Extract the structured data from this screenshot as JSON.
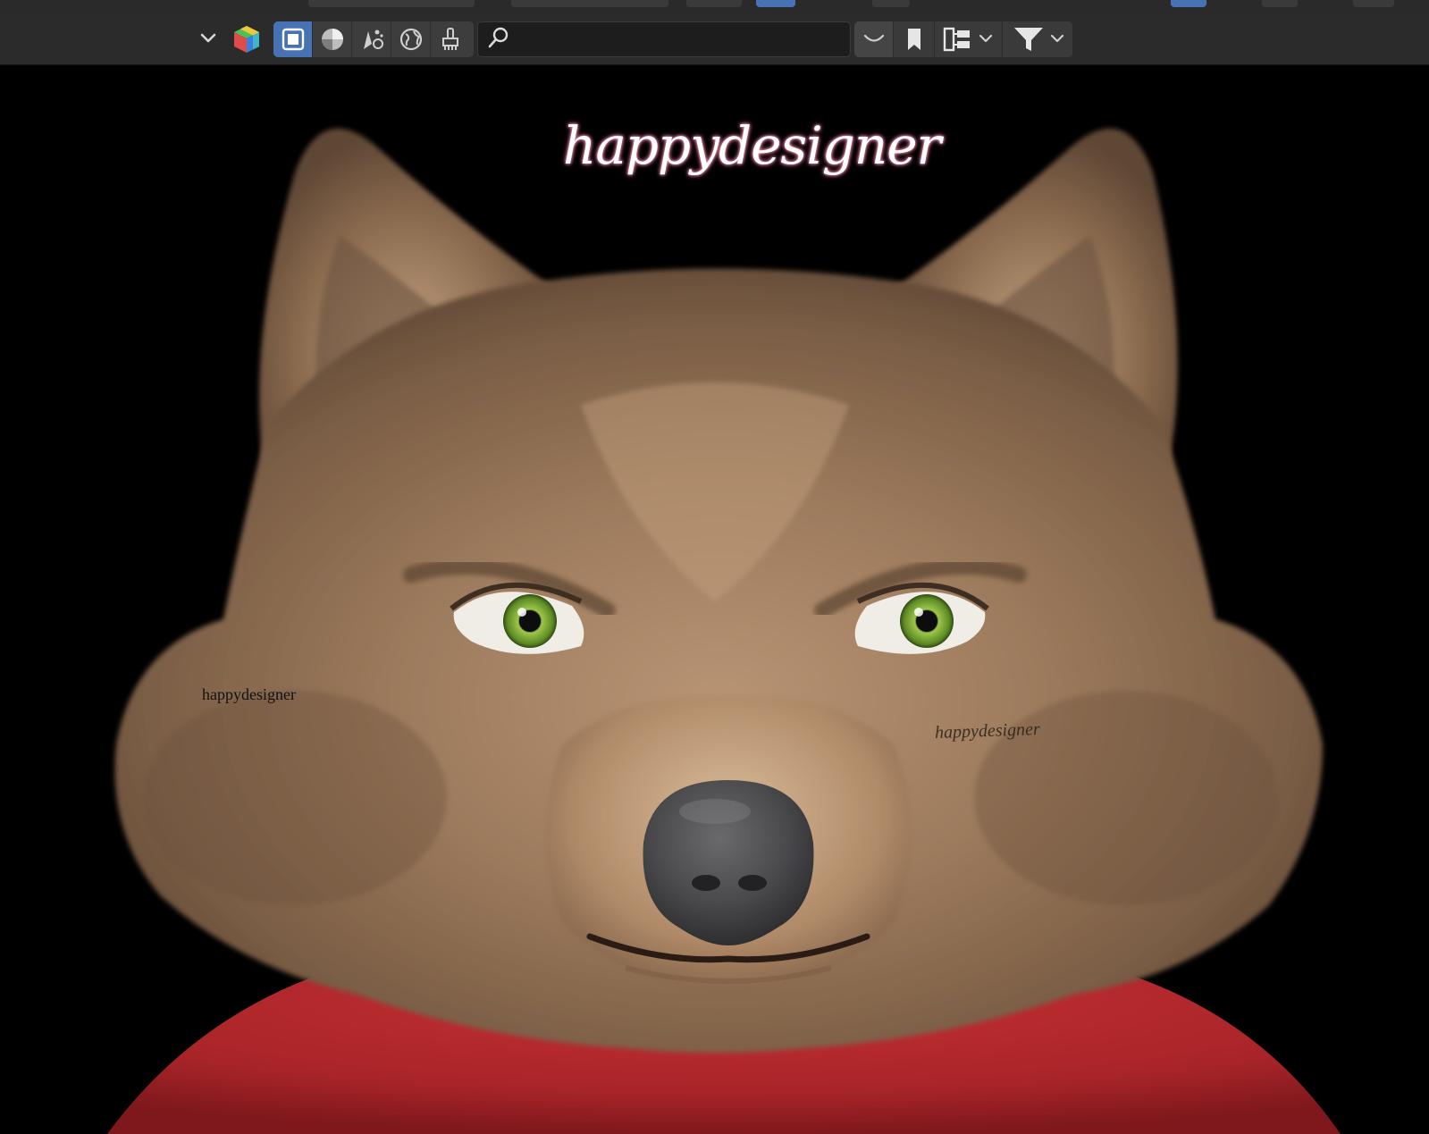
{
  "header": {
    "editor_type_icon": "cube-icon",
    "modes": [
      {
        "icon": "select-box-icon",
        "active": true
      },
      {
        "icon": "shading-icon",
        "active": false
      },
      {
        "icon": "particles-icon",
        "active": false
      },
      {
        "icon": "world-icon",
        "active": false
      },
      {
        "icon": "brush-icon",
        "active": false
      }
    ],
    "search": {
      "value": "",
      "placeholder": ""
    },
    "right_controls": [
      "viewport-display-icon",
      "bookmark-icon",
      "hierarchy-icon",
      "filter-icon"
    ]
  },
  "viewport": {
    "watermark_title": "happydesigner",
    "watermark_small_left": "happydesigner",
    "watermark_small_right": "happydesigner",
    "colors": {
      "background": "#000000",
      "fur_main": "#9c7a5c",
      "fur_light": "#c9a886",
      "fur_dark": "#5b4432",
      "nose": "#4a4a4c",
      "eye_iris": "#7fae3a",
      "shirt": "#b0272c"
    }
  },
  "colors": {
    "accent": "#4772b3",
    "header_bg": "#2b2b2b"
  }
}
